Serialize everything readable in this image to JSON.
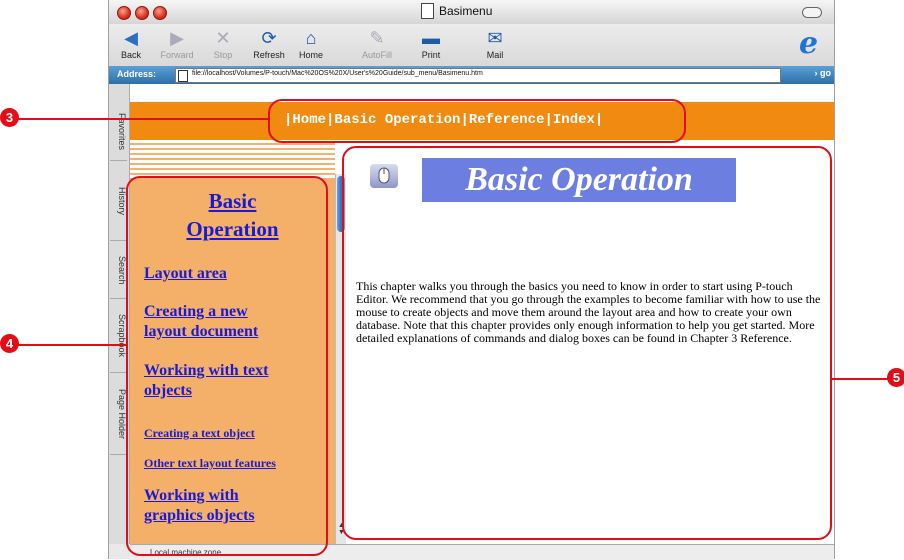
{
  "window": {
    "title": "Basimenu",
    "toolbar": [
      {
        "label": "Back",
        "icon": "back-arrow-icon",
        "enabled": true
      },
      {
        "label": "Forward",
        "icon": "forward-arrow-icon",
        "enabled": false
      },
      {
        "label": "Stop",
        "icon": "stop-icon",
        "enabled": false
      },
      {
        "label": "Refresh",
        "icon": "refresh-icon",
        "enabled": true
      },
      {
        "label": "Home",
        "icon": "home-icon",
        "enabled": true
      },
      {
        "label": "AutoFill",
        "icon": "autofill-icon",
        "enabled": false
      },
      {
        "label": "Print",
        "icon": "print-icon",
        "enabled": true
      },
      {
        "label": "Mail",
        "icon": "mail-icon",
        "enabled": true
      }
    ],
    "address_label": "Address:",
    "address_value": "file://localhost/Volumes/P-touch/Mac%20OS%20X/User's%20Guide/sub_menu/Basimenu.htm",
    "go_label": "go",
    "side_tabs": [
      "Favorites",
      "History",
      "Search",
      "Scrapbook",
      "Page Holder"
    ],
    "status_text": "Local machine zone"
  },
  "nav": {
    "sep": "|",
    "links": [
      "Home",
      "Basic Operation",
      "Reference",
      "Index"
    ]
  },
  "left_menu": {
    "title_line1": "Basic",
    "title_line2": "Operation",
    "links": [
      {
        "line1": "Layout area",
        "line2": "",
        "size": "big"
      },
      {
        "line1": "Creating a new",
        "line2": "layout document",
        "size": "big"
      },
      {
        "line1": "Working with text",
        "line2": "objects",
        "size": "big"
      },
      {
        "line1": "Creating a text object",
        "line2": "",
        "size": "small"
      },
      {
        "line1": "Other text layout features",
        "line2": "",
        "size": "small"
      },
      {
        "line1": "Working with",
        "line2": "graphics objects",
        "size": "big"
      }
    ]
  },
  "main": {
    "banner": "Basic Operation",
    "body": "This chapter walks you through the basics you need to know in order to start using P-touch Editor. We recommend that you go through the examples to become familiar with how to use the mouse to create objects and move them around the layout area and how to create your own database. Note that this chapter provides only enough information to help you get started. More detailed explanations of commands and dialog boxes can be found in Chapter 3 Reference."
  },
  "callouts": [
    "3",
    "4",
    "5"
  ],
  "colors": {
    "callout": "#e30d18",
    "nav_bar": "#f08a10",
    "left_panel": "#f4b068",
    "banner": "#6c7ee0",
    "link": "#1a1ad4"
  }
}
